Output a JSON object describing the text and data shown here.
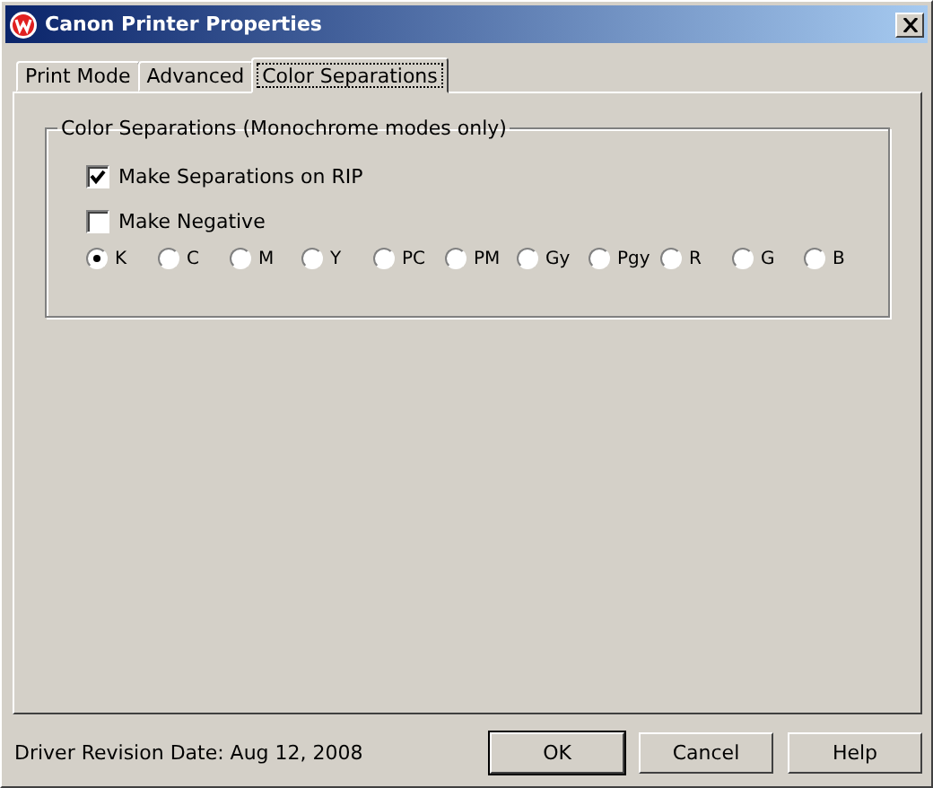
{
  "window": {
    "title": "Canon Printer Properties"
  },
  "tabs": [
    {
      "label": "Print Mode",
      "selected": false
    },
    {
      "label": "Advanced",
      "selected": false
    },
    {
      "label": "Color Separations",
      "selected": true
    }
  ],
  "group": {
    "title": "Color Separations (Monochrome modes only)",
    "checkboxes": [
      {
        "label": "Make Separations on RIP",
        "checked": true
      },
      {
        "label": "Make Negative",
        "checked": false
      }
    ],
    "radios": [
      {
        "label": "K",
        "selected": true
      },
      {
        "label": "C",
        "selected": false
      },
      {
        "label": "M",
        "selected": false
      },
      {
        "label": "Y",
        "selected": false
      },
      {
        "label": "PC",
        "selected": false
      },
      {
        "label": "PM",
        "selected": false
      },
      {
        "label": "Gy",
        "selected": false
      },
      {
        "label": "Pgy",
        "selected": false
      },
      {
        "label": "R",
        "selected": false
      },
      {
        "label": "G",
        "selected": false
      },
      {
        "label": "B",
        "selected": false
      }
    ]
  },
  "status": "Driver Revision Date: Aug 12, 2008",
  "buttons": [
    {
      "label": "OK",
      "default": true
    },
    {
      "label": "Cancel",
      "default": false
    },
    {
      "label": "Help",
      "default": false
    }
  ]
}
